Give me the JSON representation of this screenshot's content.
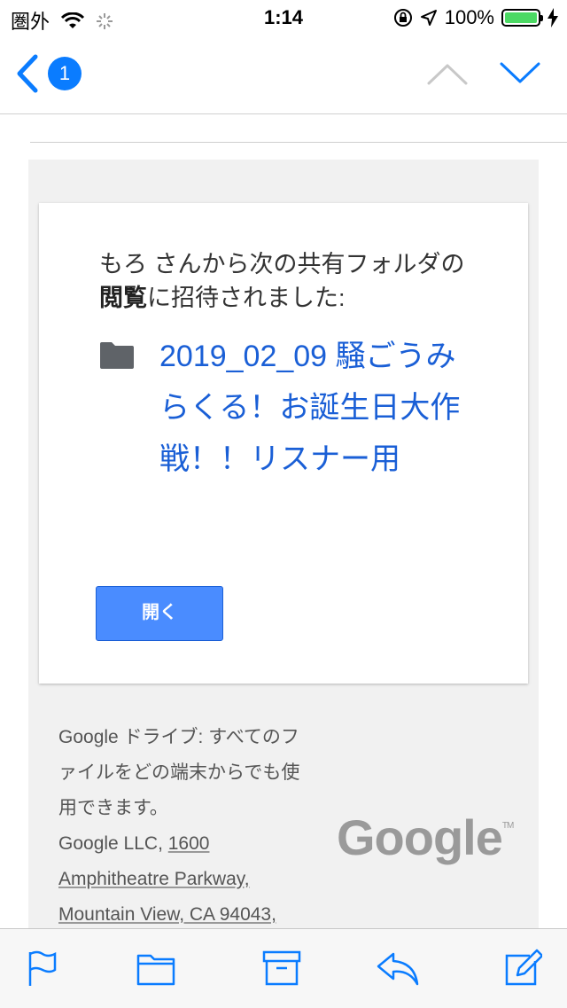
{
  "status_bar": {
    "carrier": "圏外",
    "time": "1:14",
    "battery": "100%"
  },
  "nav": {
    "unread_count": "1"
  },
  "email": {
    "intro_prefix": "もろ さんから次の共有フォルダの",
    "intro_bold": "閲覧",
    "intro_suffix": "に招待されました:",
    "folder_name": "2019_02_09 騒ごうみらくる！お誕生日大作戦！！リスナー用",
    "open_button": "開く",
    "footer_tagline": "Google ドライブ: すべてのファイルをどの端末からでも使用できます。",
    "footer_company": "Google LLC, ",
    "footer_address": "1600 Amphitheatre Parkway, Mountain View, CA 94043,",
    "logo_text": "Google",
    "logo_tm": "TM"
  },
  "colors": {
    "ios_blue": "#0a7cff",
    "link_blue": "#1a5fd6",
    "button_blue": "#4a8cff",
    "battery_green": "#4cd964"
  },
  "toolbar_icons": [
    "flag-icon",
    "folder-icon",
    "archive-icon",
    "reply-icon",
    "compose-icon"
  ]
}
